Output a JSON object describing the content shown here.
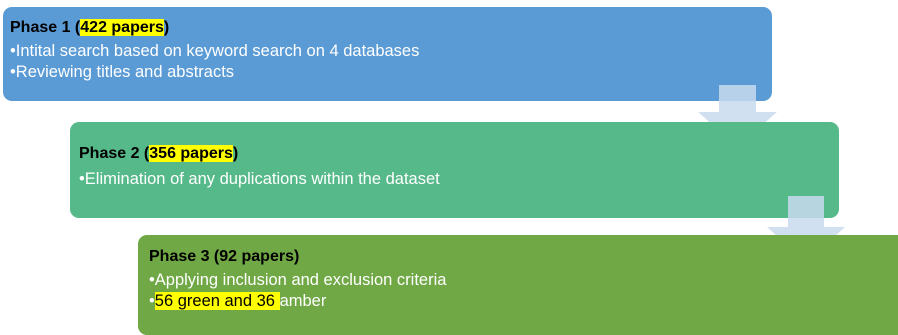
{
  "phases": [
    {
      "title_prefix": "Phase 1 (",
      "title_highlight": "422 papers",
      "title_suffix": ")",
      "bullets": [
        "•Intital search based on keyword search on 4 databases",
        "•Reviewing titles and abstracts"
      ],
      "color": "#5b9bd5"
    },
    {
      "title_prefix": "Phase 2 (",
      "title_highlight": "356 papers",
      "title_suffix": ")",
      "bullets": [
        "•Elimination of any duplications within the dataset"
      ],
      "color": "#56b98a"
    },
    {
      "title": "Phase 3 (92 papers)",
      "bullets": [
        "•Applying inclusion and exclusion criteria"
      ],
      "last_bullet": {
        "bullet": "•",
        "highlight": "56 green and 36 ",
        "rest": "amber"
      },
      "color": "#6fa844"
    }
  ],
  "arrow_color": "#c9dbef",
  "highlight_color": "#ffff00"
}
